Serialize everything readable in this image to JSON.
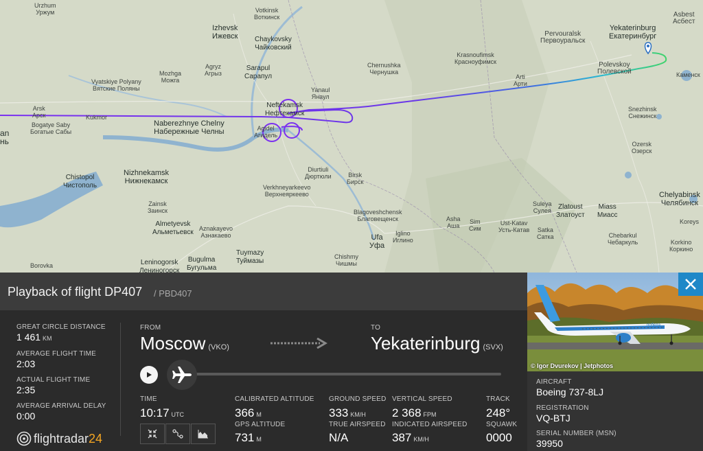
{
  "map": {
    "cities": [
      {
        "en": "Urzhum",
        "ru": "Уржум"
      },
      {
        "en": "Votkinsk",
        "ru": "Воткинск"
      },
      {
        "en": "Izhevsk",
        "ru": "Ижевск"
      },
      {
        "en": "Chaykovsky",
        "ru": "Чайковский"
      },
      {
        "en": "Pervouralsk",
        "ru": "Первоуральск"
      },
      {
        "en": "Yekaterinburg",
        "ru": "Екатеринбург"
      },
      {
        "en": "Asbest",
        "ru": "Асбест"
      },
      {
        "en": "Krasnoufimsk",
        "ru": "Красноуфимск"
      },
      {
        "en": "Polevskoy",
        "ru": "Полевской"
      },
      {
        "en": "Chernushka",
        "ru": "Чернушка"
      },
      {
        "en": "Sarapul",
        "ru": "Сарапул"
      },
      {
        "en": "Agryz",
        "ru": "Агрыз"
      },
      {
        "en": "Mozhga",
        "ru": "Можга"
      },
      {
        "en": "Vyatskiye Polyany",
        "ru": "Вятские Поляны"
      },
      {
        "en": "Arti",
        "ru": "Арти"
      },
      {
        "en": "Yanaul",
        "ru": "Янаул"
      },
      {
        "en": "Neftekamsk",
        "ru": "Нефтекамск"
      },
      {
        "en": "Snezhinsk",
        "ru": "Снежинск"
      },
      {
        "en": "Arsk",
        "ru": "Арск"
      },
      {
        "en": "Kukmor",
        "ru": "Кукмор"
      },
      {
        "en": "Bogatye Saby",
        "ru": "Богатые Сабы"
      },
      {
        "en": "Naberezhnye Chelny",
        "ru": "Набережные Челны"
      },
      {
        "en": "Agidel",
        "ru": "Агидель"
      },
      {
        "en": "Ozersk",
        "ru": "Озерск"
      },
      {
        "en": "Nizhnekamsk",
        "ru": "Нижнекамск"
      },
      {
        "en": "Chistopol",
        "ru": "Чистополь"
      },
      {
        "en": "Diurtiuli",
        "ru": "Дюртюли"
      },
      {
        "en": "Birsk",
        "ru": "Бирск"
      },
      {
        "en": "Verkhneyarkeevo",
        "ru": "Верхнеяркеево"
      },
      {
        "en": "Chelyabinsk",
        "ru": "Челябинск"
      },
      {
        "en": "Zainsk",
        "ru": "Заинск"
      },
      {
        "en": "Suleya",
        "ru": "Сулея"
      },
      {
        "en": "Zlatoust",
        "ru": "Златоуст"
      },
      {
        "en": "Miass",
        "ru": "Миасс"
      },
      {
        "en": "Blagoveshchensk",
        "ru": "Благовещенск"
      },
      {
        "en": "Asha",
        "ru": "Аша"
      },
      {
        "en": "Sim",
        "ru": "Сим"
      },
      {
        "en": "Ust-Katav",
        "ru": "Усть-Катав"
      },
      {
        "en": "Satka",
        "ru": "Сатка"
      },
      {
        "en": "Chebarkul",
        "ru": "Чебаркуль"
      },
      {
        "en": "Almetyevsk",
        "ru": "Альметьевск"
      },
      {
        "en": "Aznakayevo",
        "ru": "Азнакаево"
      },
      {
        "en": "Ufa",
        "ru": "Уфа"
      },
      {
        "en": "Iglino",
        "ru": "Иглино"
      },
      {
        "en": "Tuymazy",
        "ru": "Туймазы"
      },
      {
        "en": "Leninogorsk",
        "ru": "Лениногорск"
      },
      {
        "en": "Bugulma",
        "ru": "Бугульма"
      },
      {
        "en": "Chishmy",
        "ru": "Чишмы"
      },
      {
        "en": "Borovka",
        "ru": "Боровка"
      },
      {
        "en": "Kamensk",
        "ru": "Каменск"
      },
      {
        "en": "Korkino",
        "ru": "Коркино"
      },
      {
        "en": "Koreys",
        "ru": "Корейс"
      }
    ],
    "partial_label": "an",
    "partial_label_ru": "нь",
    "track_color_start": "#7a2ff0",
    "track_color_end": "#3fd36b"
  },
  "panel": {
    "title": "Playback of flight DP407",
    "subtitle": "/ PBD407",
    "stats": [
      {
        "label": "GREAT CIRCLE DISTANCE",
        "value": "1 461",
        "unit": "KM"
      },
      {
        "label": "AVERAGE FLIGHT TIME",
        "value": "2:03",
        "unit": ""
      },
      {
        "label": "ACTUAL FLIGHT TIME",
        "value": "2:35",
        "unit": ""
      },
      {
        "label": "AVERAGE ARRIVAL DELAY",
        "value": "0:00",
        "unit": ""
      }
    ],
    "from": {
      "label": "FROM",
      "city": "Moscow",
      "code": "(VKO)"
    },
    "to": {
      "label": "TO",
      "city": "Yekaterinburg",
      "code": "(SVX)"
    },
    "time": {
      "label": "TIME",
      "value": "10:17",
      "unit": "UTC"
    },
    "cal_alt": {
      "label": "CALIBRATED ALTITUDE",
      "value": "366",
      "unit": "M"
    },
    "gps_alt": {
      "label": "GPS ALTITUDE",
      "value": "731",
      "unit": "M"
    },
    "ground_speed": {
      "label": "GROUND SPEED",
      "value": "333",
      "unit": "KM/H"
    },
    "true_airspeed": {
      "label": "TRUE AIRSPEED",
      "value": "N/A",
      "unit": ""
    },
    "vertical_speed": {
      "label": "VERTICAL SPEED",
      "value": "2 368",
      "unit": "FPM"
    },
    "indicated_airspeed": {
      "label": "INDICATED AIRSPEED",
      "value": "387",
      "unit": "KM/H"
    },
    "track": {
      "label": "TRACK",
      "value": "248°"
    },
    "squawk": {
      "label": "SQUAWK",
      "value": "0000"
    },
    "logo_text": "flightradar",
    "logo_num": "24",
    "accent": "#f5a623"
  },
  "aside": {
    "photo_credit": "© Igor Dvurekov | Jetphotos",
    "aircraft_label": "AIRCRAFT",
    "aircraft_value": "Boeing 737-8LJ",
    "registration_label": "REGISTRATION",
    "registration_value": "VQ-BTJ",
    "serial_label": "SERIAL NUMBER (MSN)",
    "serial_value": "39950",
    "livery_text": "победа",
    "close_color": "#1e88c8"
  }
}
